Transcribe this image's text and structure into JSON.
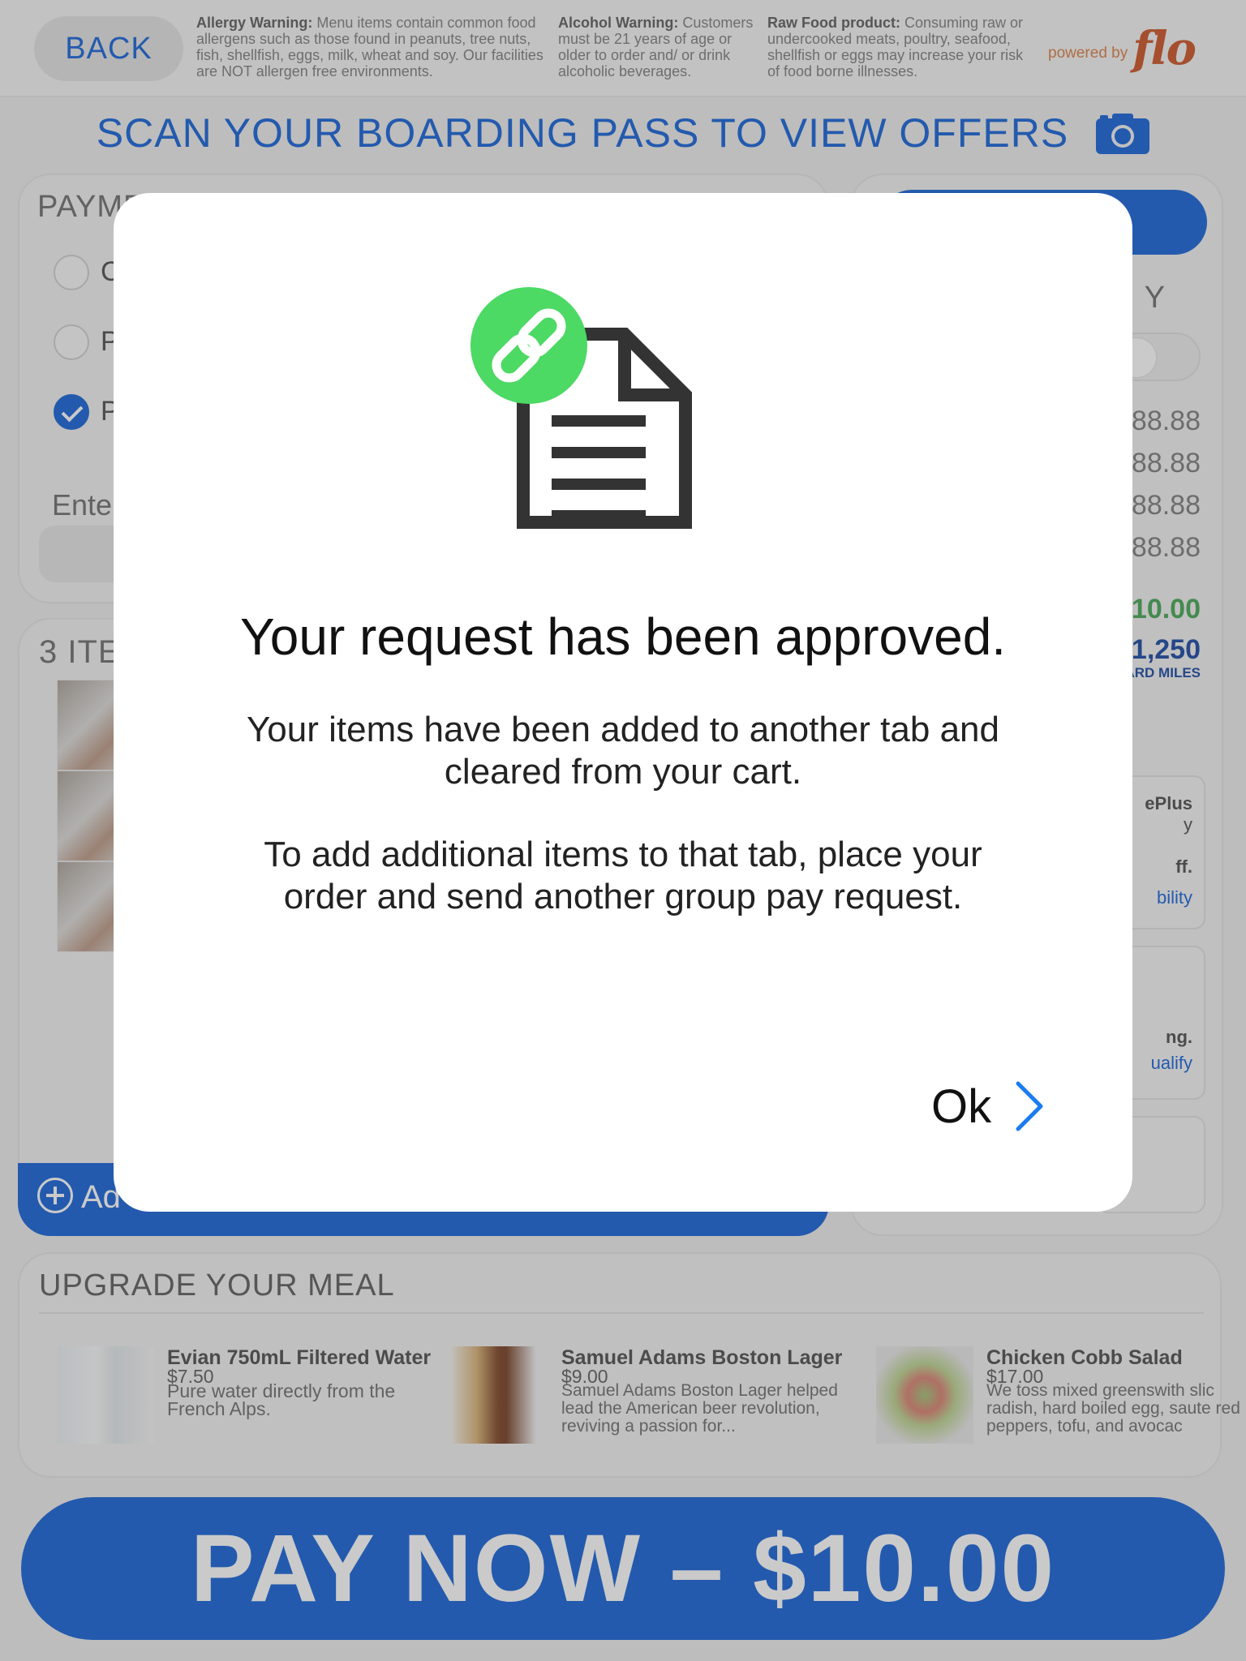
{
  "header": {
    "back_label": "BACK",
    "allergy": {
      "title": "Allergy Warning:",
      "text": " Menu items contain common food allergens such as those found in peanuts, tree nuts, fish, shellfish, eggs, milk, wheat and soy.  Our facilities are NOT allergen free environments."
    },
    "alcohol": {
      "title": "Alcohol Warning:",
      "text": " Customers must be 21 years of age or older to order and/ or drink alcoholic beverages."
    },
    "raw": {
      "title": "Raw Food product:",
      "text": " Consuming raw or undercooked meats, poultry, seafood, shellfish or eggs may increase your risk of food borne illnesses."
    },
    "powered_by": "powered by",
    "logo": "flo"
  },
  "scan": {
    "text": "SCAN YOUR BOARDING PASS TO VIEW OFFERS",
    "icon": "camera-icon"
  },
  "payment": {
    "title": "PAYME",
    "options": [
      "C",
      "P",
      "P"
    ],
    "selected_index": 2,
    "enter_label": "Enter"
  },
  "items": {
    "title": "3 ITE",
    "add_label": "Ad"
  },
  "summary": {
    "heading": "Y",
    "amounts": [
      "$88.88",
      "$88.88",
      "$88.88",
      "$88.88"
    ],
    "total": "10.00",
    "miles": "1,250",
    "miles_label": "ARD MILES",
    "offer1": {
      "title": "ePlus",
      "line2": "y",
      "line3": "ff.",
      "link": "bility"
    },
    "offer2": {
      "title": "ng.",
      "link": "ualify"
    }
  },
  "upgrade": {
    "title": "UPGRADE YOUR MEAL",
    "items": [
      {
        "name": "Evian 750mL Filtered Water",
        "price": "$7.50",
        "desc": "Pure water directly from the French Alps."
      },
      {
        "name": "Samuel Adams Boston Lager",
        "price": "$9.00",
        "desc": "Samuel Adams Boston Lager helped lead the American beer revolution, reviving a passion for..."
      },
      {
        "name": "Chicken Cobb Salad",
        "price": "$17.00",
        "desc": "We toss mixed greenswith slic radish, hard boiled egg, saute red peppers, tofu, and avocac"
      }
    ]
  },
  "pay_now": {
    "label": "PAY NOW – $10.00"
  },
  "modal": {
    "title": "Your request has been approved.",
    "body1": "Your items have been added to another tab and cleared from your cart.",
    "body2": "To add additional items to that tab, place your order and send another group pay request.",
    "ok_label": "Ok",
    "colors": {
      "link_badge": "#4cd964",
      "document": "#333333",
      "chevron": "#1a7cf0"
    }
  },
  "colors": {
    "brand_blue": "#0a5bd6",
    "green_total": "#3aa14a",
    "miles_navy": "#0d3f9e",
    "flo_orange": "#c94a1a"
  }
}
